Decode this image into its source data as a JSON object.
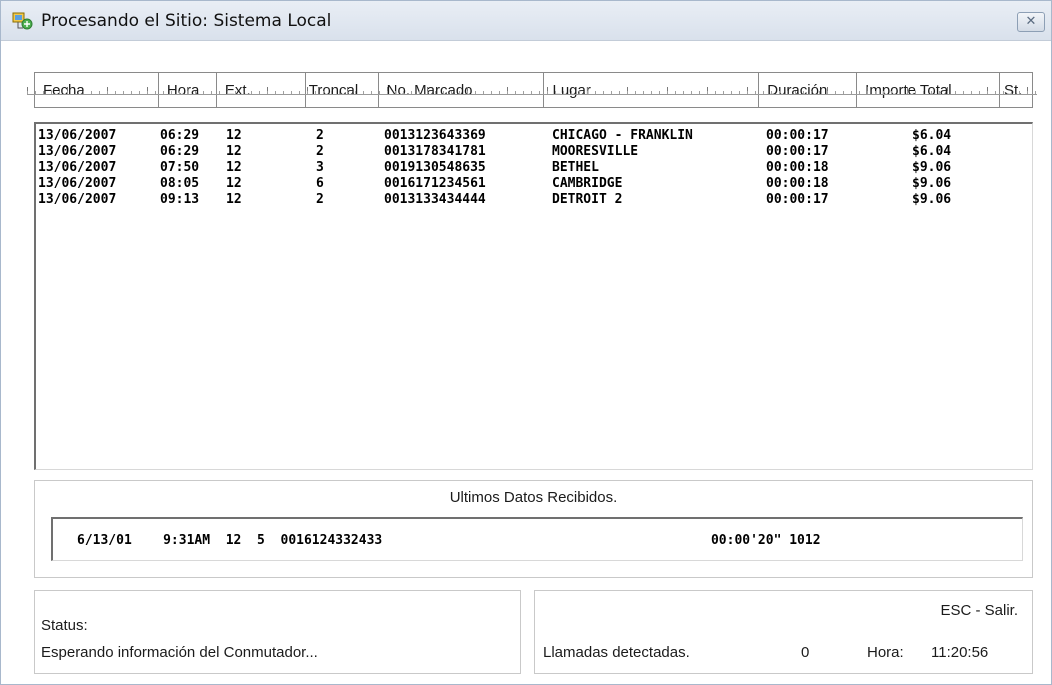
{
  "window": {
    "title": "Procesando el Sitio: Sistema Local",
    "icon": "app-network-icon",
    "close_label": "✕"
  },
  "columns": [
    "Fecha",
    "Hora",
    "Ext.",
    "Troncal",
    "No. Marcado",
    "Lugar",
    "Duración",
    "Importe Total",
    "St."
  ],
  "rows": [
    {
      "fecha": "13/06/2007",
      "hora": "06:29",
      "ext": "12",
      "troncal": "2",
      "numero": "0013123643369",
      "lugar": "CHICAGO - FRANKLIN",
      "duracion": "00:00:17",
      "importe": "$6.04"
    },
    {
      "fecha": "13/06/2007",
      "hora": "06:29",
      "ext": "12",
      "troncal": "2",
      "numero": "0013178341781",
      "lugar": "MOORESVILLE",
      "duracion": "00:00:17",
      "importe": "$6.04"
    },
    {
      "fecha": "13/06/2007",
      "hora": "07:50",
      "ext": "12",
      "troncal": "3",
      "numero": "0019130548635",
      "lugar": "BETHEL",
      "duracion": "00:00:18",
      "importe": "$9.06"
    },
    {
      "fecha": "13/06/2007",
      "hora": "08:05",
      "ext": "12",
      "troncal": "6",
      "numero": "0016171234561",
      "lugar": "CAMBRIDGE",
      "duracion": "00:00:18",
      "importe": "$9.06"
    },
    {
      "fecha": "13/06/2007",
      "hora": "09:13",
      "ext": "12",
      "troncal": "2",
      "numero": "0013133434444",
      "lugar": "DETROIT 2",
      "duracion": "00:00:17",
      "importe": "$9.06"
    }
  ],
  "last_data": {
    "title": "Ultimos Datos Recibidos.",
    "line": "6/13/01    9:31AM  12  5  0016124332433                                          00:00'20\" 1012"
  },
  "status": {
    "label": "Status:",
    "message": "Esperando información del Conmutador..."
  },
  "info": {
    "esc_label": "ESC - Salir.",
    "calls_label": "Llamadas detectadas.",
    "calls_count": "0",
    "hora_label": "Hora:",
    "hora_value": "11:20:56"
  }
}
